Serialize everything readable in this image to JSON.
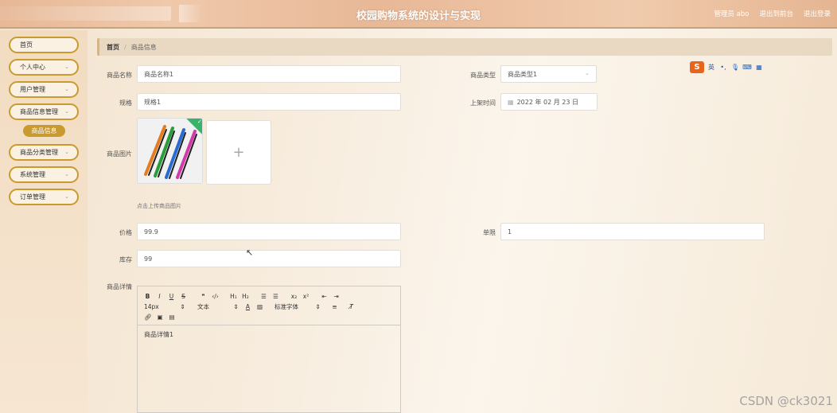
{
  "header": {
    "title": "校园购物系统的设计与实现",
    "links": [
      "管理员 abo",
      "退出到前台",
      "退出登录"
    ]
  },
  "sidebar": {
    "items": [
      {
        "label": "首页",
        "has_arrow": false
      },
      {
        "label": "个人中心",
        "has_arrow": true
      },
      {
        "label": "用户管理",
        "has_arrow": true
      },
      {
        "label": "商品信息管理",
        "has_arrow": true
      },
      {
        "label": "商品分类管理",
        "has_arrow": true
      },
      {
        "label": "系统管理",
        "has_arrow": true
      },
      {
        "label": "订单管理",
        "has_arrow": true
      }
    ],
    "active_sub": "商品信息"
  },
  "breadcrumb": {
    "home": "首页",
    "separator": "/",
    "current": "商品信息"
  },
  "form": {
    "name": {
      "label": "商品名称",
      "value": "商品名称1"
    },
    "type": {
      "label": "商品类型",
      "value": "商品类型1"
    },
    "spec": {
      "label": "规格",
      "value": "规格1"
    },
    "date": {
      "label": "上架时间",
      "value": "2022 年 02 月 23 日"
    },
    "image": {
      "label": "商品图片",
      "hint": "点击上传商品图片",
      "upload_symbol": "+"
    },
    "price": {
      "label": "价格",
      "value": "99.9"
    },
    "limit": {
      "label": "单限",
      "value": "1"
    },
    "stock": {
      "label": "库存",
      "value": "99"
    },
    "detail": {
      "label": "商品详情",
      "content": "商品详情1",
      "font_size": "14px",
      "text_type": "文本",
      "font_family": "标准字体"
    }
  },
  "ime": {
    "logo": "S",
    "lang": "英"
  },
  "watermark": "CSDN @ck3021",
  "colors": {
    "accent": "#c99a2e",
    "header": "#e8b897",
    "check": "#3bb26a"
  }
}
